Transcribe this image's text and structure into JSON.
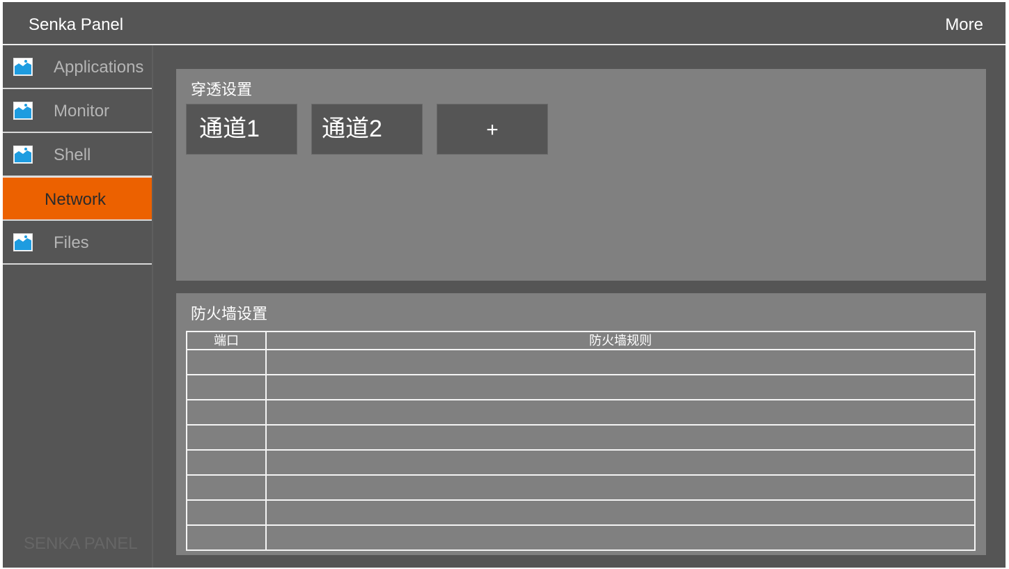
{
  "header": {
    "title": "Senka Panel",
    "more_label": "More"
  },
  "sidebar": {
    "items": [
      {
        "label": "Applications",
        "icon": "image-icon",
        "active": false
      },
      {
        "label": "Monitor",
        "icon": "image-icon",
        "active": false
      },
      {
        "label": "Shell",
        "icon": "image-icon",
        "active": false
      },
      {
        "label": "Network",
        "icon": "",
        "active": true
      },
      {
        "label": "Files",
        "icon": "image-icon",
        "active": false
      }
    ],
    "brand": "SENKA PANEL"
  },
  "tunnel_panel": {
    "title": "穿透设置",
    "channels": [
      "通道1",
      "通道2"
    ],
    "add_label": "+"
  },
  "firewall_panel": {
    "title": "防火墙设置",
    "columns": [
      "端口",
      "防火墙规则"
    ],
    "rows": [
      [
        "",
        ""
      ],
      [
        "",
        ""
      ],
      [
        "",
        ""
      ],
      [
        "",
        ""
      ],
      [
        "",
        ""
      ],
      [
        "",
        ""
      ],
      [
        "",
        ""
      ],
      [
        "",
        ""
      ]
    ]
  },
  "colors": {
    "accent": "#ec6100",
    "icon_blue": "#1e9ce0",
    "background": "#555555",
    "panel": "#808080"
  }
}
